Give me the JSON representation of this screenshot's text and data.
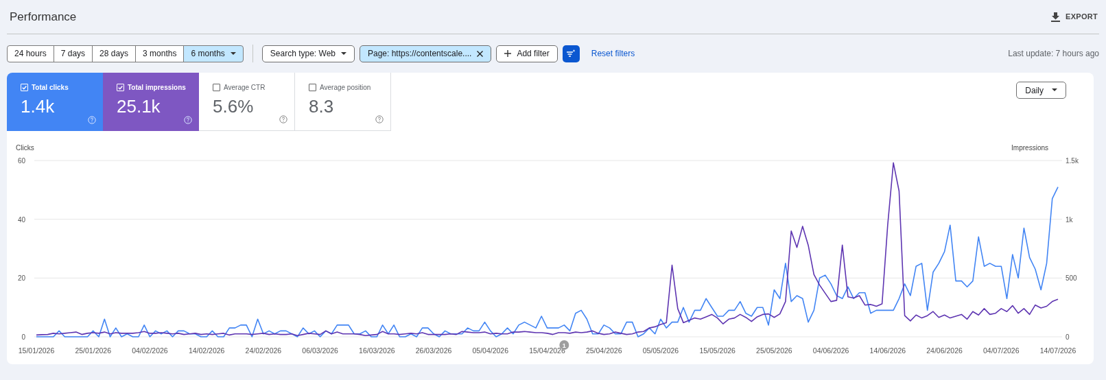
{
  "header": {
    "title": "Performance",
    "export": "EXPORT"
  },
  "date_ranges": [
    {
      "label": "24 hours",
      "selected": false
    },
    {
      "label": "7 days",
      "selected": false
    },
    {
      "label": "28 days",
      "selected": false
    },
    {
      "label": "3 months",
      "selected": false
    },
    {
      "label": "6 months",
      "selected": true
    }
  ],
  "filters": [
    {
      "kind": "dropdown",
      "label": "Search type: Web",
      "active": false
    },
    {
      "kind": "removable",
      "label": "Page: https://contentscale....",
      "active": true
    },
    {
      "kind": "add",
      "label": "Add filter",
      "active": false
    }
  ],
  "reset_filters": "Reset filters",
  "last_update": "Last update: 7 hours ago",
  "metrics": [
    {
      "label": "Total clicks",
      "value": "1.4k",
      "checked": true,
      "color": "#4285f4"
    },
    {
      "label": "Total impressions",
      "value": "25.1k",
      "checked": true,
      "color": "#7e57c2"
    },
    {
      "label": "Average CTR",
      "value": "5.6%",
      "checked": false
    },
    {
      "label": "Average position",
      "value": "8.3",
      "checked": false
    }
  ],
  "granularity": "Daily",
  "chart_data": {
    "type": "line",
    "categories": [
      "15/01/2026",
      null,
      null,
      null,
      null,
      null,
      null,
      null,
      null,
      null,
      "25/01/2026",
      null,
      null,
      null,
      null,
      null,
      null,
      null,
      null,
      null,
      "04/02/2026",
      null,
      null,
      null,
      null,
      null,
      null,
      null,
      null,
      null,
      "14/02/2026",
      null,
      null,
      null,
      null,
      null,
      null,
      null,
      null,
      null,
      "24/02/2026",
      null,
      null,
      null,
      null,
      null,
      null,
      null,
      null,
      null,
      "06/03/2026",
      null,
      null,
      null,
      null,
      null,
      null,
      null,
      null,
      null,
      "16/03/2026",
      null,
      null,
      null,
      null,
      null,
      null,
      null,
      null,
      null,
      "26/03/2026",
      null,
      null,
      null,
      null,
      null,
      null,
      null,
      null,
      null,
      "05/04/2026",
      null,
      null,
      null,
      null,
      null,
      null,
      null,
      null,
      null,
      "15/04/2026",
      null,
      null,
      null,
      null,
      null,
      null,
      null,
      null,
      null,
      "25/04/2026",
      null,
      null,
      null,
      null,
      null,
      null,
      null,
      null,
      null,
      "05/05/2026",
      null,
      null,
      null,
      null,
      null,
      null,
      null,
      null,
      null,
      "15/05/2026",
      null,
      null,
      null,
      null,
      null,
      null,
      null,
      null,
      null,
      "25/05/2026",
      null,
      null,
      null,
      null,
      null,
      null,
      null,
      null,
      null,
      "04/06/2026",
      null,
      null,
      null,
      null,
      null,
      null,
      null,
      null,
      null,
      "14/06/2026",
      null,
      null,
      null,
      null,
      null,
      null,
      null,
      null,
      null,
      "24/06/2026",
      null,
      null,
      null,
      null,
      null,
      null,
      null,
      null,
      null,
      "04/07/2026",
      null,
      null,
      null,
      null,
      null,
      null,
      null,
      null,
      null,
      "14/07/2026"
    ],
    "ylabel": "Clicks",
    "y2label": "Impressions",
    "ylim": [
      0,
      60
    ],
    "y2lim": [
      0,
      1500
    ],
    "yticks": [
      0,
      20,
      40,
      60
    ],
    "y2ticks": [
      {
        "value": 0,
        "label": "0"
      },
      {
        "value": 500,
        "label": "500"
      },
      {
        "value": 1000,
        "label": "1k"
      },
      {
        "value": 1500,
        "label": "1.5k"
      }
    ],
    "series": [
      {
        "color": "#4285f4",
        "values": [
          0,
          0,
          0,
          0,
          2,
          0,
          0,
          0,
          0,
          0,
          2,
          0,
          6,
          0,
          3,
          0,
          1,
          0,
          0,
          4,
          0,
          2,
          1,
          2,
          0,
          2,
          2,
          1,
          1,
          0,
          0,
          2,
          0,
          0,
          3,
          3,
          4,
          4,
          0,
          6,
          1,
          2,
          1,
          2,
          2,
          1,
          0,
          3,
          1,
          2,
          0,
          2,
          1,
          4,
          4,
          4,
          1,
          1,
          2,
          0,
          0,
          4,
          1,
          4,
          0,
          0,
          1,
          0,
          3,
          3,
          1,
          0,
          2,
          1,
          1,
          1,
          3,
          2,
          2,
          5,
          2,
          0,
          1,
          3,
          1,
          4,
          5,
          4,
          3,
          7,
          3,
          3,
          3,
          4,
          2,
          8,
          9,
          6,
          1,
          1,
          4,
          3,
          1,
          1,
          5,
          5,
          0,
          1,
          3,
          1,
          6,
          3,
          5,
          5,
          10,
          5,
          9,
          9,
          13,
          10,
          7,
          7,
          9,
          9,
          12,
          8,
          7,
          10,
          10,
          4,
          16,
          13,
          25,
          12,
          14,
          13,
          5,
          9,
          20,
          21,
          18,
          14,
          13,
          17,
          13,
          15,
          15,
          8,
          9,
          9,
          9,
          9,
          13,
          18,
          14,
          24,
          25,
          9,
          22,
          25,
          29,
          38,
          19,
          19,
          17,
          19,
          34,
          24,
          25,
          24,
          24,
          13,
          28,
          20,
          37,
          27,
          23,
          16,
          25,
          47,
          51
        ]
      },
      {
        "axis": "y2",
        "color": "#5e35b1",
        "values": [
          15,
          18,
          20,
          30,
          25,
          30,
          35,
          40,
          20,
          30,
          35,
          30,
          40,
          25,
          35,
          30,
          30,
          30,
          35,
          45,
          30,
          30,
          35,
          30,
          25,
          30,
          20,
          25,
          30,
          20,
          25,
          20,
          25,
          30,
          15,
          25,
          25,
          25,
          20,
          25,
          30,
          20,
          25,
          20,
          20,
          25,
          10,
          20,
          30,
          25,
          20,
          50,
          25,
          40,
          25,
          25,
          25,
          20,
          10,
          15,
          20,
          45,
          25,
          25,
          20,
          25,
          30,
          25,
          35,
          20,
          20,
          20,
          20,
          25,
          20,
          45,
          40,
          35,
          35,
          40,
          25,
          30,
          25,
          25,
          40,
          40,
          45,
          40,
          35,
          35,
          30,
          20,
          35,
          35,
          30,
          40,
          35,
          40,
          50,
          30,
          20,
          25,
          40,
          30,
          20,
          25,
          40,
          45,
          75,
          85,
          105,
          120,
          610,
          240,
          120,
          140,
          160,
          150,
          170,
          190,
          160,
          110,
          150,
          160,
          190,
          165,
          130,
          170,
          190,
          195,
          165,
          195,
          300,
          900,
          760,
          940,
          780,
          530,
          440,
          370,
          300,
          310,
          780,
          340,
          330,
          350,
          270,
          275,
          260,
          280,
          950,
          1480,
          1240,
          180,
          135,
          185,
          160,
          180,
          215,
          165,
          185,
          160,
          175,
          190,
          150,
          215,
          185,
          240,
          190,
          200,
          240,
          215,
          265,
          200,
          240,
          190,
          270,
          245,
          260,
          300,
          320
        ]
      }
    ],
    "annotations": [
      "1"
    ]
  }
}
